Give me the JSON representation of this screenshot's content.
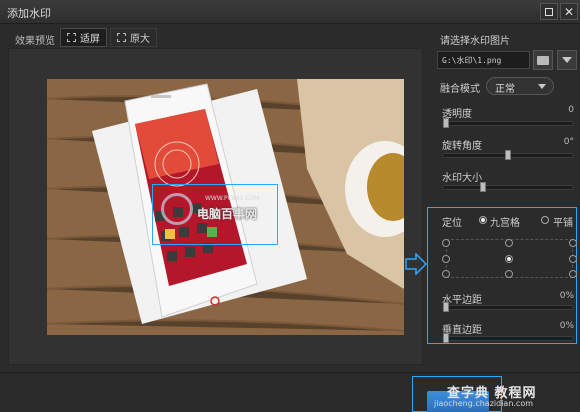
{
  "window": {
    "title": "添加水印"
  },
  "preview": {
    "label": "效果预览",
    "fit_label": "适屏",
    "original_label": "原大"
  },
  "watermark": {
    "url_text": "WWW.PC841.COM",
    "brand_text": "电脑百事网"
  },
  "panel": {
    "choose_image_label": "请选择水印图片",
    "path_value": "G:\\水印\\1.png",
    "blend_label": "融合模式",
    "blend_value": "正常",
    "opacity_label": "透明度",
    "opacity_value": "0",
    "opacity_level": 0,
    "rotation_label": "旋转角度",
    "rotation_value": "0°",
    "rotation_level": 0.5,
    "size_label": "水印大小",
    "size_level": 0.3,
    "position_label": "定位",
    "grid_option_label": "九宫格",
    "tile_option_label": "平铺",
    "h_margin_label": "水平边距",
    "h_margin_value": "0%",
    "v_margin_label": "垂直边距",
    "v_margin_value": "0%"
  },
  "footer": {
    "brand": "查字典 教程网",
    "site": "jiaocheng.chazidian.com"
  }
}
